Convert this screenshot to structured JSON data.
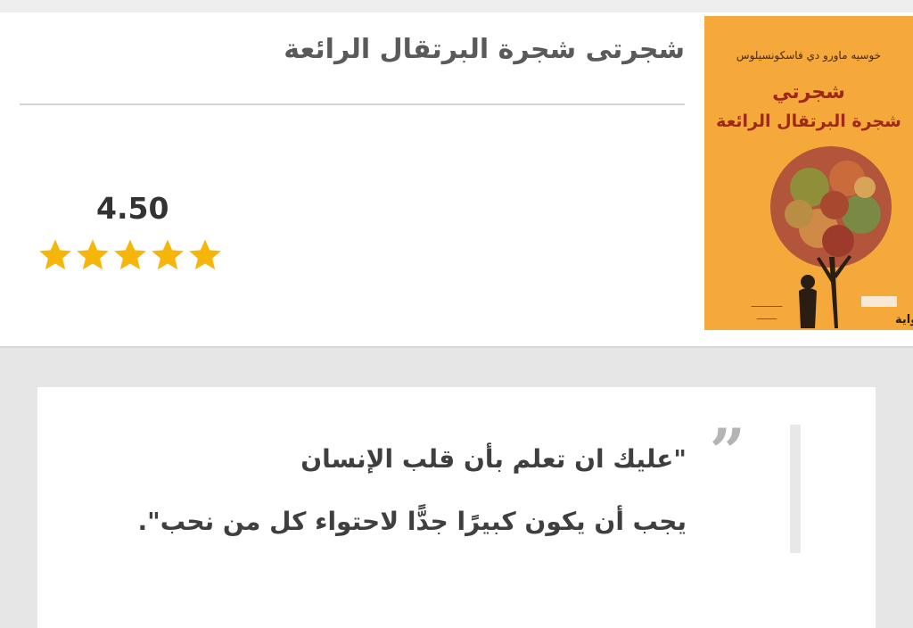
{
  "book": {
    "title": "شجرتى شجرة البرتقال الرائعة",
    "rating": "4.50",
    "stars": 5,
    "star_color": "#f5b50a"
  },
  "cover": {
    "author": "خوسيه ماورو دي فاسكونسيلوس",
    "title_line1": "شجرتي",
    "title_line2": "شجرة البرتقال الرائعة",
    "genre": "رواية",
    "background_color": "#f5a93a"
  },
  "quote": {
    "line1": "\"عليك ان تعلم بأن قلب الإنسان",
    "line2": "يجب أن يكون كبيرًا جدًّا لاحتواء كل من نحب\"."
  },
  "icons": {
    "quote": "quote-icon",
    "star": "star-icon"
  }
}
